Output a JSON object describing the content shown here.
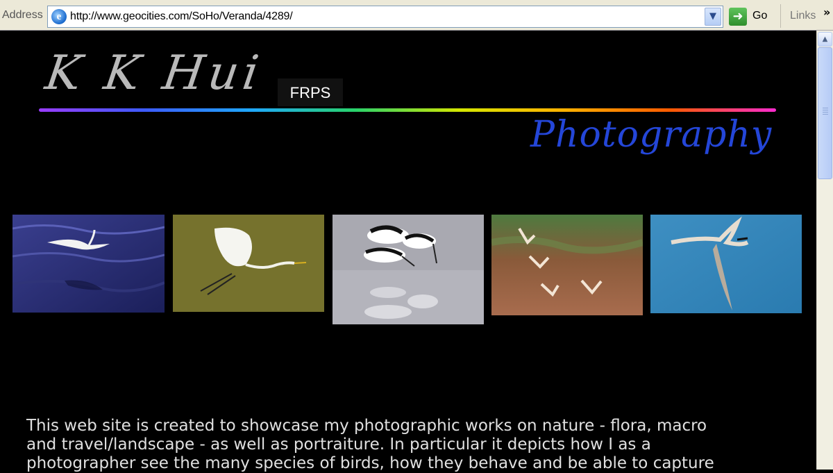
{
  "browser": {
    "address_label": "Address",
    "url": "http://www.geocities.com/SoHo/Veranda/4289/",
    "go_label": "Go",
    "links_label": "Links"
  },
  "page": {
    "name": "K K Hui",
    "credential": "FRPS",
    "subtitle": "Photography",
    "intro_lines": [
      "This web site is created to showcase my photographic works on nature - flora, macro",
      "and travel/landscape - as well as portraiture. In particular it depicts how I as a",
      "photographer see the many species of birds, how they behave and be able to capture"
    ]
  },
  "colors": {
    "background": "#000000",
    "title": "#b9b9b9",
    "subtitle": "#2446d8",
    "text": "#e0e0e0"
  }
}
